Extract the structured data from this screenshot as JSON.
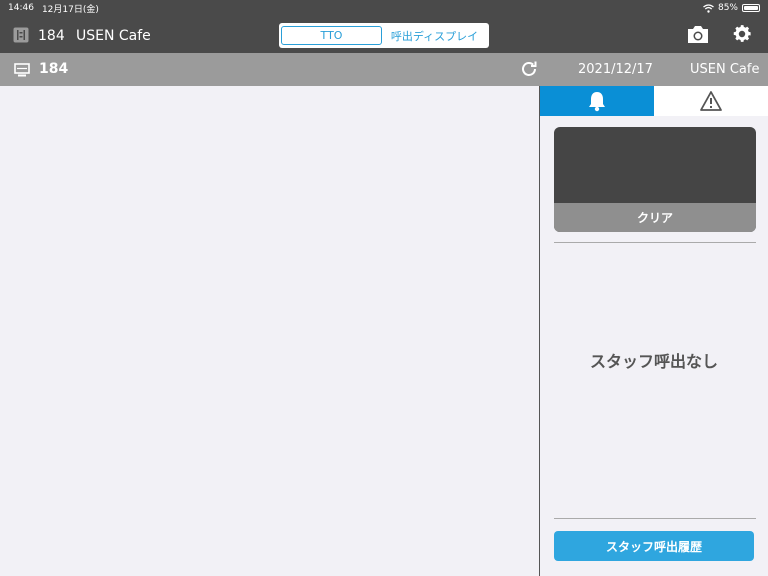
{
  "status_bar": {
    "time": "14:46",
    "date": "12月17日(金)",
    "battery": "85%"
  },
  "header": {
    "store_number": "184",
    "store_name": "USEN Cafe",
    "segments": [
      {
        "label": "TTO",
        "active": true
      },
      {
        "label": "呼出ディスプレイ",
        "active": false
      }
    ]
  },
  "subheader": {
    "table_number": "184",
    "date": "2021/12/17",
    "shop_name": "USEN Cafe"
  },
  "panel": {
    "tabs": [
      {
        "icon": "bell-icon",
        "active": true
      },
      {
        "icon": "warning-icon",
        "active": false
      }
    ],
    "clear_label": "クリア",
    "empty_message": "スタッフ呼出なし",
    "history_label": "スタッフ呼出履歴"
  },
  "colors": {
    "header_bg": "#4a4a4a",
    "subheader_bg": "#9b9b9b",
    "accent": "#0a8fd6",
    "button_blue": "#2fa6df"
  }
}
